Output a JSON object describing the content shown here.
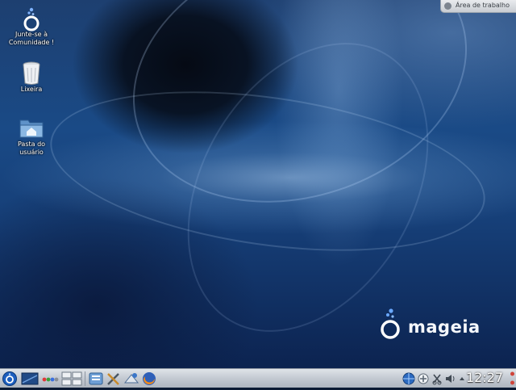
{
  "desktop": {
    "icons": [
      {
        "label": "Junte-se à Comunidade !",
        "icon": "mageia-community-icon"
      },
      {
        "label": "Lixeira",
        "icon": "trash-icon"
      },
      {
        "label": "Pasta do usuário",
        "icon": "home-folder-icon"
      }
    ],
    "toolbox_label": "Área de trabalho",
    "logo_text": "mageia"
  },
  "taskbar": {
    "launchers": [
      "mageia-menu-icon",
      "show-desktop-icon",
      "color-dots-icon",
      "pager-icon",
      "file-manager-icon",
      "tools-icon",
      "mail-client-icon",
      "firefox-icon"
    ],
    "tray": [
      "network-globe-icon",
      "update-icon",
      "clipboard-icon",
      "volume-icon",
      "tray-expand-icon"
    ],
    "clock": "12:27"
  },
  "colors": {
    "accent": "#2a5ea8",
    "taskbar": "#c4cad2"
  }
}
